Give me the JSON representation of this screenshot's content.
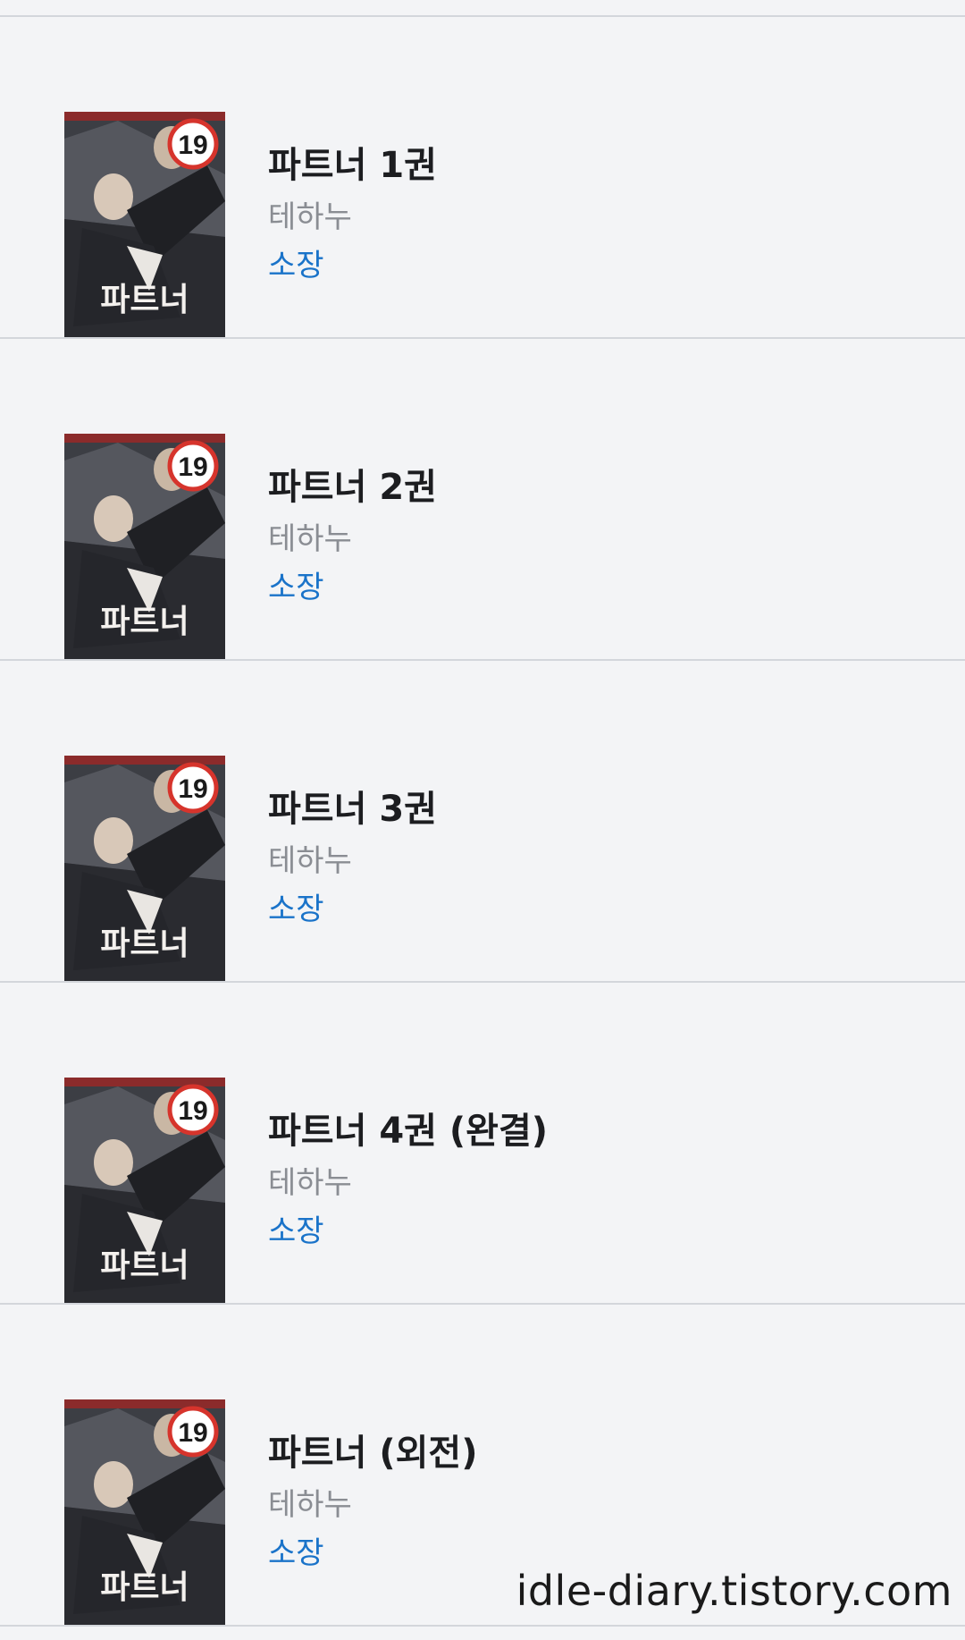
{
  "items": [
    {
      "title": "파트너 1권",
      "author": "테하누",
      "status": "소장",
      "cover": {
        "rating": "19",
        "cover_title": "파트너"
      }
    },
    {
      "title": "파트너 2권",
      "author": "테하누",
      "status": "소장",
      "cover": {
        "rating": "19",
        "cover_title": "파트너"
      }
    },
    {
      "title": "파트너 3권",
      "author": "테하누",
      "status": "소장",
      "cover": {
        "rating": "19",
        "cover_title": "파트너"
      }
    },
    {
      "title": "파트너 4권 (완결)",
      "author": "테하누",
      "status": "소장",
      "cover": {
        "rating": "19",
        "cover_title": "파트너"
      }
    },
    {
      "title": "파트너 (외전)",
      "author": "테하누",
      "status": "소장",
      "cover": {
        "rating": "19",
        "cover_title": "파트너"
      }
    }
  ],
  "watermark": "idle-diary.tistory.com",
  "colors": {
    "background": "#f3f4f6",
    "divider": "#d3d6db",
    "title": "#1c1d20",
    "author": "#8a8d93",
    "status": "#1a73c9",
    "rating_badge": "#d6342c"
  }
}
